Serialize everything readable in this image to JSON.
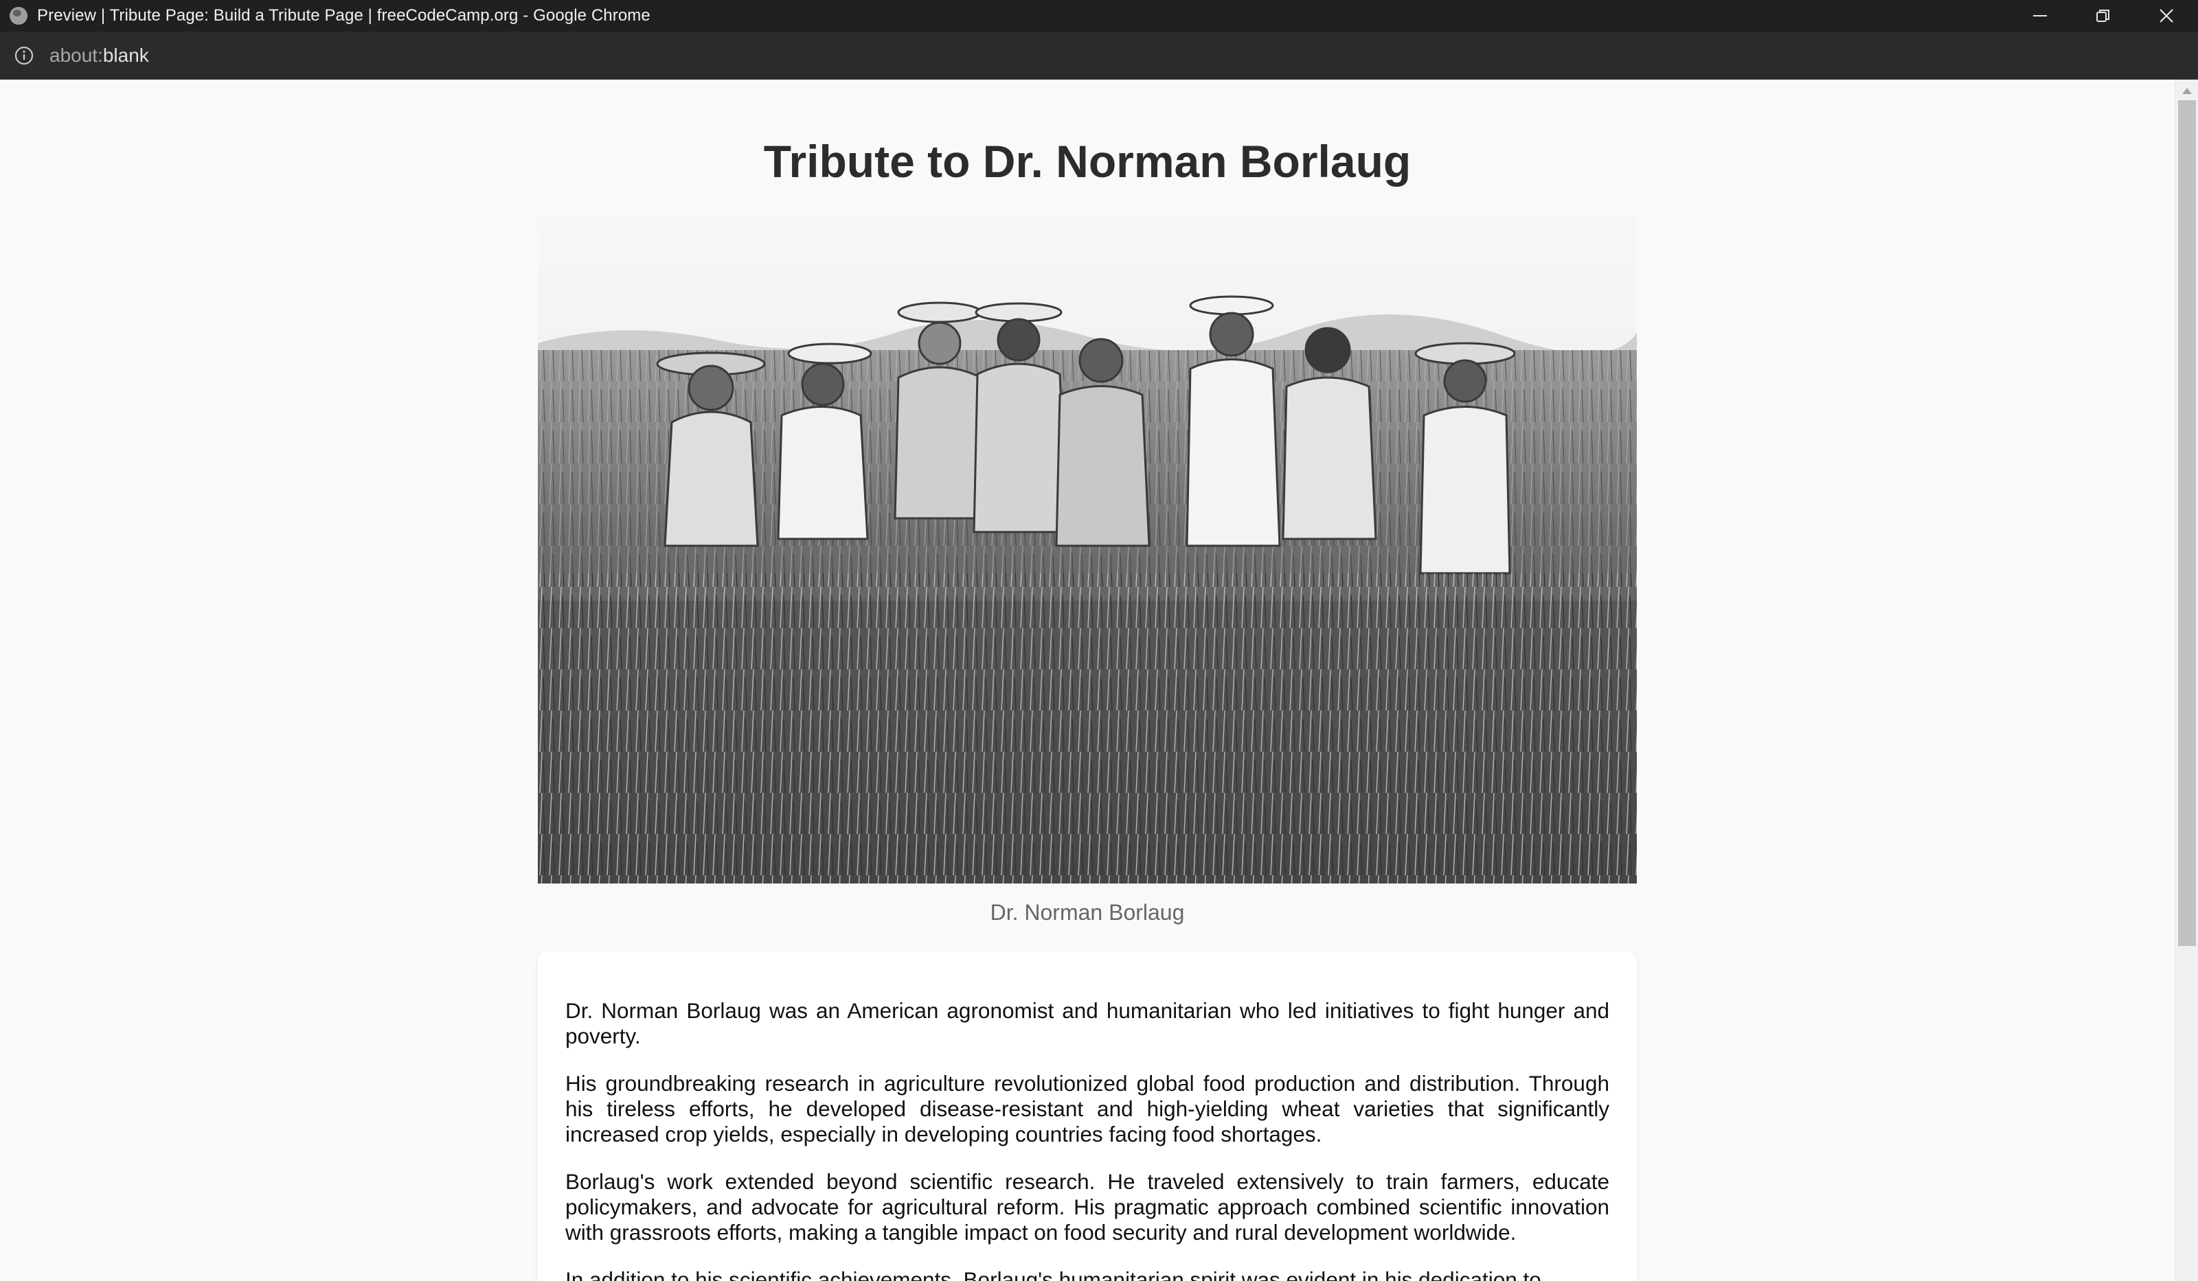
{
  "window": {
    "title": "Preview | Tribute Page: Build a Tribute Page | freeCodeCamp.org - Google Chrome",
    "controls": [
      "minimize",
      "restore",
      "close"
    ]
  },
  "address_bar": {
    "scheme": "about:",
    "path": "blank"
  },
  "page": {
    "title": "Tribute to Dr. Norman Borlaug",
    "image_caption": "Dr. Norman Borlaug",
    "paragraphs": [
      "Dr. Norman Borlaug was an American agronomist and humanitarian who led initiatives to fight hunger and poverty.",
      "His groundbreaking research in agriculture revolutionized global food production and distribution. Through his tireless efforts, he developed disease-resistant and high-yielding wheat varieties that significantly increased crop yields, especially in developing countries facing food shortages.",
      "Borlaug's work extended beyond scientific research. He traveled extensively to train farmers, educate policymakers, and advocate for agricultural reform. His pragmatic approach combined scientific innovation with grassroots efforts, making a tangible impact on food security and rural development worldwide.",
      "In addition to his scientific achievements, Borlaug's humanitarian spirit was evident in his dedication to"
    ]
  }
}
